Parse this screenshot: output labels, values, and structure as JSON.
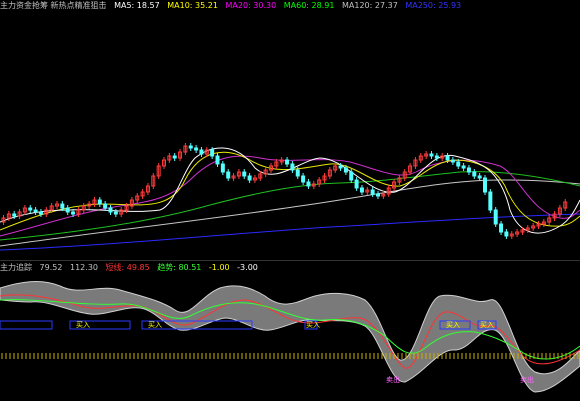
{
  "top_legend": {
    "title": "主力资金抢筹 新热点精准狙击",
    "items": [
      {
        "label": "MA5: 18.57",
        "color": "#ffffff"
      },
      {
        "label": "MA10: 35.21",
        "color": "#ffff00"
      },
      {
        "label": "MA20: 30.30",
        "color": "#ff00ff"
      },
      {
        "label": "MA60: 28.91",
        "color": "#00ff00"
      },
      {
        "label": "MA120: 27.37",
        "color": "#c0c0c0"
      },
      {
        "label": "MA250: 25.93",
        "color": "#3333ff"
      }
    ]
  },
  "bottom_legend": {
    "title": "主力追踪",
    "items": [
      {
        "label": "79.52",
        "color": "#c0c0c0"
      },
      {
        "label": "112.30",
        "color": "#c0c0c0"
      },
      {
        "label": "短线: 49.85",
        "color": "#ff3333"
      },
      {
        "label": "趋势: 80.51",
        "color": "#33ff33"
      },
      {
        "label": "-1.00",
        "color": "#ffff00"
      },
      {
        "label": "-3.00",
        "color": "#ffffff"
      }
    ]
  },
  "buy_markers": [
    {
      "label": "买入"
    },
    {
      "label": "买入"
    },
    {
      "label": "买入"
    },
    {
      "label": "买入"
    },
    {
      "label": "买入"
    }
  ],
  "sell_markers": [
    {
      "label": "卖出"
    },
    {
      "label": "卖出"
    }
  ],
  "colors": {
    "up": "#ff3c3c",
    "down": "#54ffff",
    "band": "#7a7a7a",
    "signal_box": "#2a3dff"
  }
}
